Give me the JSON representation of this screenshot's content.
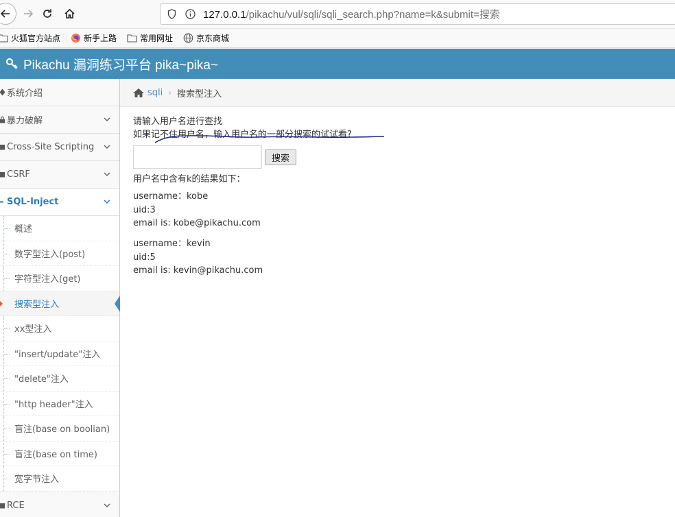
{
  "browser": {
    "url_host": "127.0.0.1",
    "url_path": "/pikachu/vul/sqli/sqli_search.php?name=k&submit=搜索"
  },
  "bookmarks": [
    {
      "label": "火狐官方站点",
      "icon": "firefox-folder-icon"
    },
    {
      "label": "新手上路",
      "icon": "firefox-icon"
    },
    {
      "label": "常用网址",
      "icon": "folder-icon"
    },
    {
      "label": "京东商城",
      "icon": "globe-icon"
    }
  ],
  "app": {
    "title": "Pikachu 漏洞练习平台 pika~pika~",
    "accent": "#438eb9"
  },
  "sidebar": {
    "items": [
      {
        "label": "系统介绍"
      },
      {
        "label": "暴力破解"
      },
      {
        "label": "Cross-Site Scripting"
      },
      {
        "label": "CSRF"
      },
      {
        "label": "SQL-Inject"
      }
    ],
    "sub_items": [
      {
        "label": "概述"
      },
      {
        "label": "数字型注入(post)"
      },
      {
        "label": "字符型注入(get)"
      },
      {
        "label": "搜索型注入"
      },
      {
        "label": "xx型注入"
      },
      {
        "label": "\"insert/update\"注入"
      },
      {
        "label": "\"delete\"注入"
      },
      {
        "label": "\"http header\"注入"
      },
      {
        "label": "盲注(base on boolian)"
      },
      {
        "label": "盲注(base on time)"
      },
      {
        "label": "宽字节注入"
      }
    ],
    "last_item": {
      "label": "RCE"
    }
  },
  "breadcrumb": {
    "link": "sqli",
    "current": "搜索型注入"
  },
  "main": {
    "hint_line1": "请输入用户名进行查找",
    "hint_line2": "如果记不住用户名，输入用户名的一部分搜索的试试看?",
    "search_value": "",
    "search_button": "搜索",
    "result_title": "用户名中含有k的结果如下：",
    "results": [
      {
        "username": "username：kobe",
        "uid": "uid:3",
        "email": "email is: kobe@pikachu.com"
      },
      {
        "username": "username：kevin",
        "uid": "uid:5",
        "email": "email is: kevin@pikachu.com"
      }
    ]
  }
}
